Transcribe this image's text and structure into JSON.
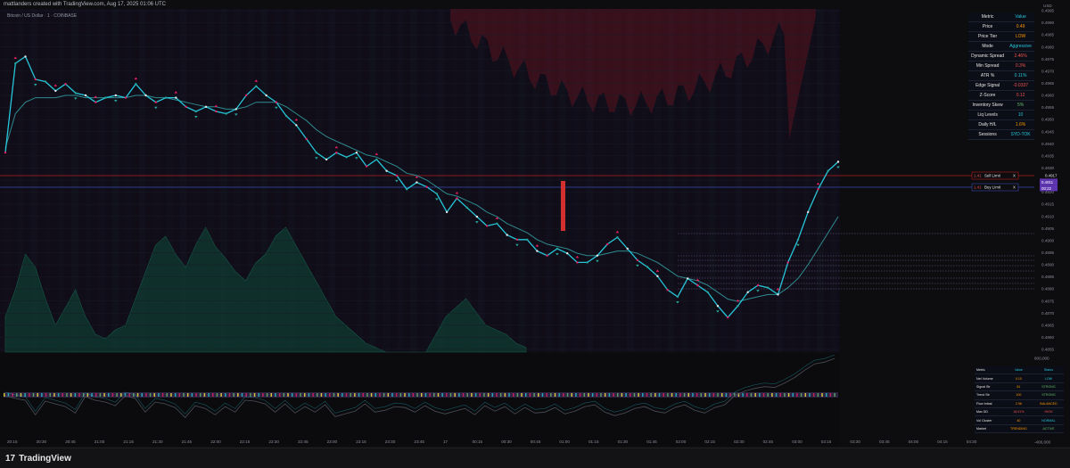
{
  "header": {
    "title": "mattlanders created with TradingView.com, Aug 17, 2025 01:06 UTC",
    "symbol_line": "Bitcoin / US Dollar · 1 · COINBASE"
  },
  "footer": {
    "brand": "TradingView"
  },
  "colors": {
    "background": "#0d0d10",
    "price_line": "#26c6da",
    "ema": "#2e8b8f",
    "sell": "#e91e63",
    "buy": "#26a69a",
    "volume_area": "#0f3b30",
    "resistance_area": "#5a1420",
    "sell_level": "#b71c1c",
    "buy_level": "#3949ab",
    "last_price_tag": "#5e35b1",
    "text_orange": "#ff9800",
    "text_red": "#ef5350",
    "text_green": "#66bb6a",
    "text_teal": "#26c6da"
  },
  "chart_data": [
    {
      "type": "line",
      "x_tick_labels": [
        "20:15",
        "20:30",
        "20:45",
        "21:00",
        "21:15",
        "21:30",
        "21:45",
        "22:00",
        "22:15",
        "22:30",
        "22:45",
        "23:00",
        "23:15",
        "23:30",
        "23:45",
        "17",
        "00:15",
        "00:30",
        "00:45",
        "01:00",
        "01:15",
        "01:30",
        "01:45",
        "02:00",
        "02:15",
        "02:30",
        "02:45",
        "03:00",
        "03:15",
        "03:30",
        "03:45",
        "04:00",
        "04:15",
        "04:30"
      ],
      "y_tick_labels": [
        "0.4995",
        "0.4990",
        "0.4985",
        "0.4980",
        "0.4975",
        "0.4970",
        "0.4965",
        "0.4960",
        "0.4955",
        "0.4950",
        "0.4945",
        "0.4940",
        "0.4935",
        "0.4930",
        "0.4925",
        "0.4920",
        "0.4915",
        "0.4910",
        "0.4905",
        "0.4900",
        "0.4895",
        "0.4890",
        "0.4885",
        "0.4880",
        "0.4875",
        "0.4870",
        "0.4865",
        "0.4860",
        "0.4855"
      ],
      "ylim": [
        0.4852,
        0.5
      ],
      "y_axis_label": "USD",
      "series": [
        {
          "name": "price",
          "color": "#26c6da",
          "values": [
            0.4938,
            0.4977,
            0.498,
            0.497,
            0.4969,
            0.4965,
            0.4968,
            0.4964,
            0.4963,
            0.496,
            0.4962,
            0.4963,
            0.4962,
            0.4968,
            0.4963,
            0.496,
            0.4962,
            0.4962,
            0.4958,
            0.4956,
            0.4958,
            0.4956,
            0.4955,
            0.4957,
            0.4963,
            0.4967,
            0.4963,
            0.496,
            0.4954,
            0.495,
            0.4944,
            0.4938,
            0.4935,
            0.4938,
            0.4936,
            0.4938,
            0.4932,
            0.4935,
            0.493,
            0.4928,
            0.4922,
            0.4925,
            0.4923,
            0.492,
            0.4912,
            0.4918,
            0.4914,
            0.491,
            0.4906,
            0.4907,
            0.4902,
            0.49,
            0.49,
            0.4895,
            0.4893,
            0.4896,
            0.4894,
            0.489,
            0.489,
            0.4893,
            0.4898,
            0.4901,
            0.4896,
            0.4891,
            0.4888,
            0.4884,
            0.4878,
            0.4875,
            0.4883,
            0.488,
            0.4877,
            0.4871,
            0.4866,
            0.4871,
            0.4877,
            0.488,
            0.4879,
            0.4876,
            0.489,
            0.49,
            0.4912,
            0.4922,
            0.493,
            0.4934
          ]
        },
        {
          "name": "ema",
          "color": "#2e8b8f",
          "values": [
            0.494,
            0.4955,
            0.496,
            0.4962,
            0.4962,
            0.4962,
            0.4963,
            0.4963,
            0.4962,
            0.4962,
            0.4962,
            0.4962,
            0.4962,
            0.4963,
            0.4963,
            0.4962,
            0.4962,
            0.4961,
            0.496,
            0.4959,
            0.4958,
            0.4958,
            0.4957,
            0.4957,
            0.4958,
            0.496,
            0.496,
            0.496,
            0.4958,
            0.4955,
            0.4952,
            0.4948,
            0.4945,
            0.4943,
            0.4941,
            0.4939,
            0.4937,
            0.4936,
            0.4934,
            0.4932,
            0.4929,
            0.4928,
            0.4926,
            0.4923,
            0.492,
            0.4919,
            0.4917,
            0.4915,
            0.4912,
            0.491,
            0.4907,
            0.4905,
            0.4903,
            0.49,
            0.4898,
            0.4897,
            0.4896,
            0.4894,
            0.4893,
            0.4893,
            0.4894,
            0.4895,
            0.4895,
            0.4894,
            0.4892,
            0.489,
            0.4887,
            0.4884,
            0.4883,
            0.4882,
            0.488,
            0.4877,
            0.4874,
            0.4873,
            0.4874,
            0.4875,
            0.4876,
            0.4876,
            0.4879,
            0.4883,
            0.4889,
            0.4896,
            0.4903,
            0.491
          ]
        }
      ],
      "price_tags": [
        {
          "label": "0.4911",
          "role": "last"
        },
        {
          "label": "00:22",
          "role": "countdown"
        }
      ],
      "level_lines": [
        {
          "name": "sell_limit",
          "tag_left": "1.41",
          "tag_mid": "Sell Limit",
          "tag_right": "X",
          "price": "0.4917"
        },
        {
          "name": "buy_limit",
          "tag_left": "1.41",
          "tag_mid": "Buy Limit",
          "tag_right": "X",
          "price": "0.4910"
        }
      ]
    },
    {
      "type": "line",
      "name": "oscillator",
      "y_tick_labels": [
        "600,000",
        "400,000",
        "200,000",
        "0",
        "-200,000",
        "-400,000"
      ],
      "ylim": [
        -400000,
        600000
      ],
      "series": [
        {
          "name": "net_volume",
          "color": "#26c6da",
          "values": [
            150000,
            120000,
            100000,
            -60000,
            90000,
            60000,
            30000,
            -40000,
            140000,
            100000,
            80000,
            40000,
            150000,
            120000,
            -30000,
            80000,
            60000,
            20000,
            -90000,
            40000,
            10000,
            -60000,
            30000,
            -30000,
            100000,
            90000,
            60000,
            -30000,
            60000,
            -40000,
            30000,
            -30000,
            50000,
            -80000,
            -50000,
            -20000,
            60000,
            -30000,
            -10000,
            30000,
            20000,
            -30000,
            40000,
            -20000,
            -50000,
            -20000,
            10000,
            -60000,
            40000,
            -20000,
            30000,
            -50000,
            20000,
            -40000,
            -30000,
            20000,
            -50000,
            -20000,
            30000,
            50000,
            -30000,
            -70000,
            -40000,
            10000,
            30000,
            -20000,
            -40000,
            20000,
            50000,
            -10000,
            -40000,
            20000,
            50000,
            150000,
            200000,
            230000,
            250000,
            240000,
            290000,
            350000,
            430000,
            500000,
            520000,
            560000
          ]
        }
      ]
    }
  ],
  "metrics_table": {
    "header": [
      "Metric",
      "Value"
    ],
    "rows": [
      {
        "metric": "Price",
        "value": "0.49",
        "color": "#ff9800"
      },
      {
        "metric": "Price Tier",
        "value": "LOW",
        "color": "#ff9800"
      },
      {
        "metric": "Mode",
        "value": "Aggressive",
        "color": "#26c6da"
      },
      {
        "metric": "Dynamic Spread",
        "value": "2.46%",
        "color": "#ef5350"
      },
      {
        "metric": "Min Spread",
        "value": "0.3%",
        "color": "#ef5350"
      },
      {
        "metric": "ATR %",
        "value": "0.11%",
        "color": "#26c6da"
      },
      {
        "metric": "Edge Signal",
        "value": "-0.0337",
        "color": "#ef5350"
      },
      {
        "metric": "Z-Score",
        "value": "0.12",
        "color": "#ef5350"
      },
      {
        "metric": "Inventory Skew",
        "value": "5%",
        "color": "#66bb6a"
      },
      {
        "metric": "Liq Levels",
        "value": "10",
        "color": "#26c6da"
      },
      {
        "metric": "Daily H/L",
        "value": "1.6%",
        "color": "#ff9800"
      },
      {
        "metric": "Sessions",
        "value": "SYD-TOK",
        "color": "#26c6da"
      }
    ]
  },
  "status_table": {
    "header": [
      "Metric",
      "Value",
      "Status"
    ],
    "rows": [
      {
        "metric": "Net Volume",
        "value": "0.10",
        "status": "LOW",
        "vcolor": "#ff9800",
        "scolor": "#26c6da"
      },
      {
        "metric": "Signal Str",
        "value": "81",
        "status": "STRONG",
        "vcolor": "#ff9800",
        "scolor": "#66bb6a"
      },
      {
        "metric": "Trend Str",
        "value": "100",
        "status": "STRONG",
        "vcolor": "#ff9800",
        "scolor": "#66bb6a"
      },
      {
        "metric": "Flow Imbal",
        "value": "2.96",
        "status": "BALANCED",
        "vcolor": "#ff9800",
        "scolor": "#ff9800"
      },
      {
        "metric": "Max DD",
        "value": "18.91%",
        "status": "HIGH",
        "vcolor": "#ef5350",
        "scolor": "#ef5350"
      },
      {
        "metric": "Vol Cluster",
        "value": "40",
        "status": "NORMAL",
        "vcolor": "#ff9800",
        "scolor": "#26c6da"
      },
      {
        "metric": "Market",
        "value": "TRENDING",
        "status": "ACTIVE",
        "vcolor": "#ff9800",
        "scolor": "#66bb6a"
      }
    ]
  }
}
